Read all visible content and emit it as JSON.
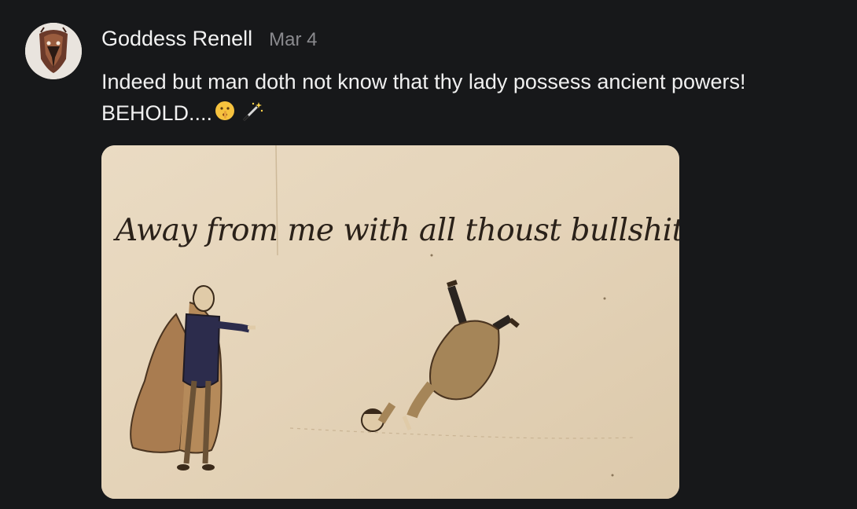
{
  "post": {
    "author": "Goddess Renell",
    "date": "Mar 4",
    "text_line1": "Indeed but man doth not know that thy lady possess ancient powers!",
    "text_line2": "BEHOLD....",
    "emojis": [
      "shushing-face-emoji",
      "magic-wand-emoji"
    ]
  },
  "image": {
    "caption": "Away from me with all thoust bullshittery",
    "description_icon": "medieval-tapestry-meme"
  },
  "colors": {
    "background": "#17181a",
    "text": "#f0f0f0",
    "muted": "#8a8a8e",
    "parchment": "#e6d6bd"
  }
}
